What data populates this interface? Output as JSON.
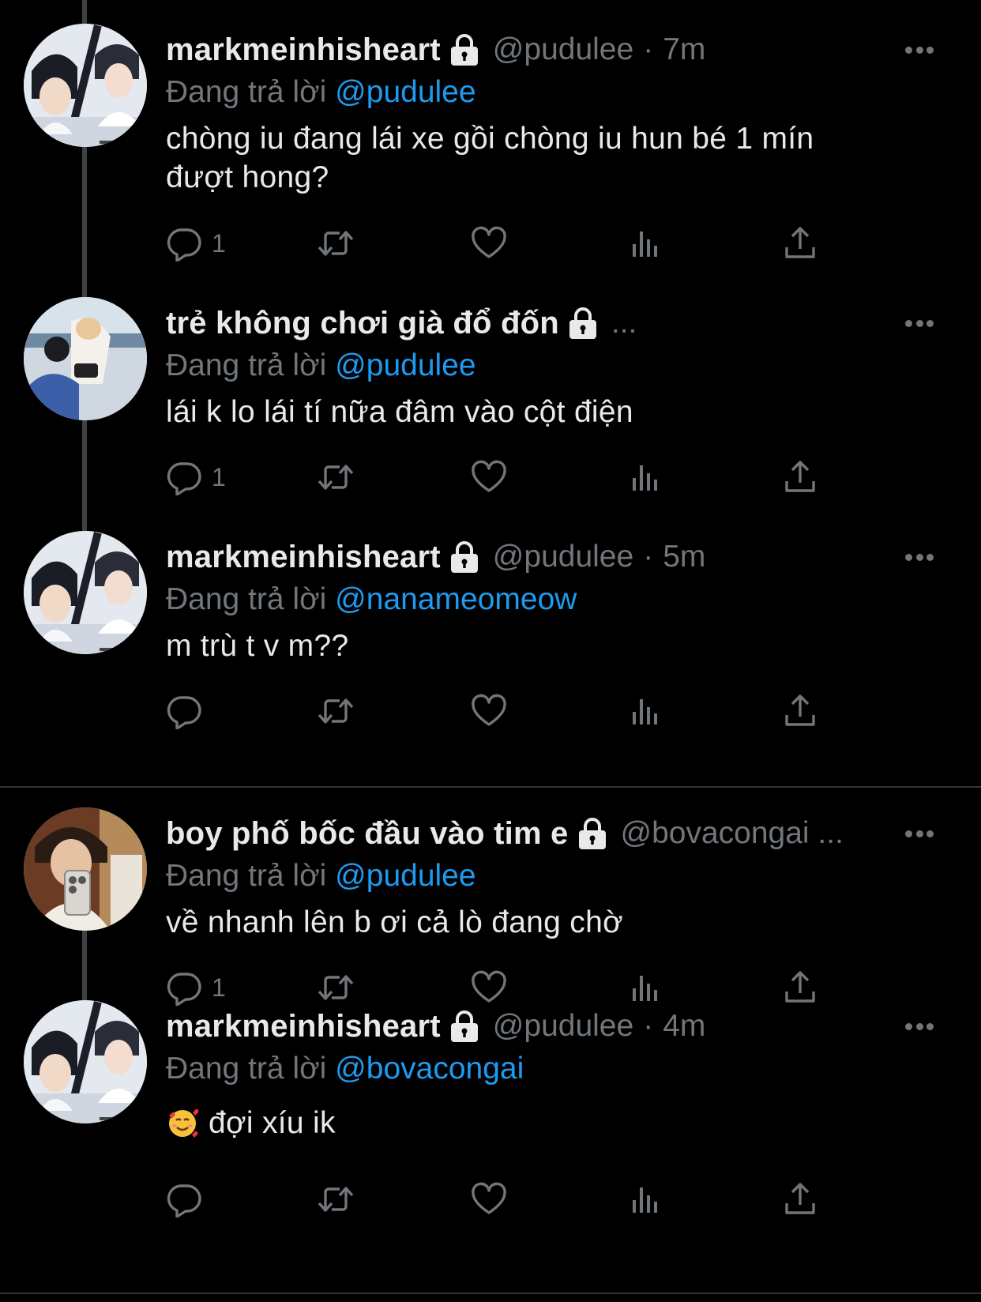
{
  "tweets": [
    {
      "display_name": "markmeinhisheart",
      "handle": "@pudulee",
      "separator": "·",
      "time": "7m",
      "reply_prefix": "Đang trả lời",
      "reply_to": "@pudulee",
      "text_line1": "chòng iu đang lái xe gồi chòng iu hun bé 1 mín",
      "text_line2": "đượt hong?",
      "reply_count": "1"
    },
    {
      "display_name": "trẻ không chơi già đổ đốn",
      "handle": "...",
      "reply_prefix": "Đang trả lời",
      "reply_to": "@pudulee",
      "text_line1": "lái k lo lái tí nữa đâm vào cột điện",
      "reply_count": "1"
    },
    {
      "display_name": "markmeinhisheart",
      "handle": "@pudulee",
      "separator": "·",
      "time": "5m",
      "reply_prefix": "Đang trả lời",
      "reply_to": "@nanameomeow",
      "text_line1": "m trù t v m??",
      "reply_count": ""
    },
    {
      "display_name": "boy phố bốc đầu vào tim e",
      "handle": "@bovacongai ...",
      "reply_prefix": "Đang trả lời",
      "reply_to": "@pudulee",
      "text_line1": "về nhanh lên b ơi cả lò đang chờ",
      "reply_count": "1"
    },
    {
      "display_name": "markmeinhisheart",
      "handle": "@pudulee",
      "separator": "·",
      "time": "4m",
      "reply_prefix": "Đang trả lời",
      "reply_to": "@bovacongai",
      "emoji": "smiling-face-with-hearts",
      "text_line1": "đợi xíu ik",
      "reply_count": ""
    }
  ],
  "icons": {
    "reply": "reply-icon",
    "retweet": "retweet-icon",
    "like": "heart-icon",
    "views": "views-icon",
    "share": "share-icon",
    "more": "more-icon",
    "lock": "lock-icon"
  },
  "colors": {
    "background": "#000000",
    "text": "#e7e9ea",
    "muted": "#71767b",
    "link": "#1d9bf0",
    "thread_line": "#3e4144",
    "divider": "#2f3336"
  }
}
